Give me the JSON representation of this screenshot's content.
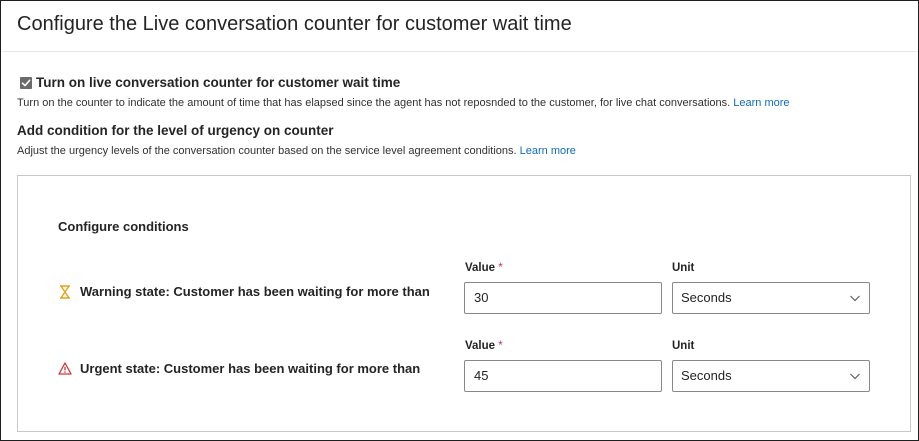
{
  "title": "Configure the Live conversation counter for customer wait time",
  "counter_toggle": {
    "label": "Turn on live conversation counter for customer wait time",
    "checked": true,
    "description": "Turn on the counter to indicate the amount of time that has elapsed since the agent has not reposnded to the customer, for live chat conversations.",
    "learn_more": "Learn more"
  },
  "urgency": {
    "heading": "Add condition for the level of urgency on counter",
    "description": "Adjust the urgency levels of the conversation counter based on the service level agreement conditions.",
    "learn_more": "Learn more"
  },
  "conditions": {
    "title": "Configure conditions",
    "value_label": "Value",
    "required_marker": "*",
    "unit_label": "Unit",
    "warning": {
      "label": "Warning state: Customer has been waiting for more than",
      "icon": "hourglass-icon",
      "icon_color": "#e8a317",
      "value": "30",
      "unit": "Seconds"
    },
    "urgent": {
      "label": "Urgent state: Customer has been waiting for more than",
      "icon": "warning-triangle-icon",
      "icon_color": "#d13438",
      "value": "45",
      "unit": "Seconds"
    }
  },
  "colors": {
    "link": "#0f6cbd",
    "required": "#c4314b"
  }
}
